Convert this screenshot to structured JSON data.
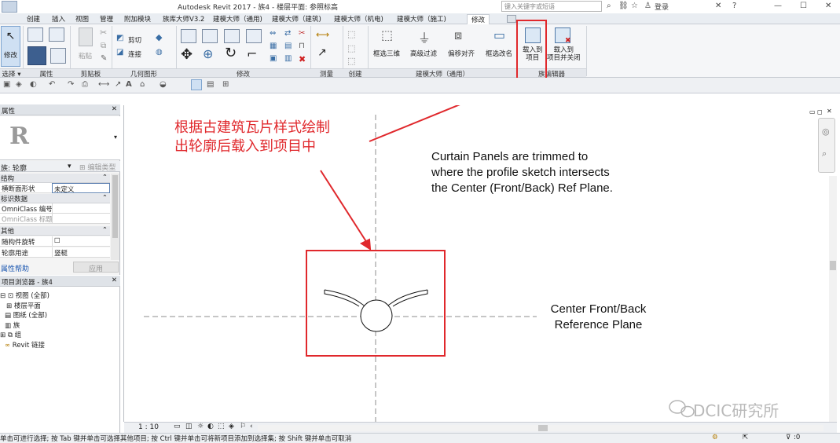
{
  "app": {
    "title": "Autodesk Revit 2017 -     族4 - 楼层平面: 参照标高",
    "search_placeholder": "键入关键字或短语",
    "login_label": "登录"
  },
  "tabs": [
    {
      "label": "创建"
    },
    {
      "label": "插入"
    },
    {
      "label": "视图"
    },
    {
      "label": "管理"
    },
    {
      "label": "附加模块"
    },
    {
      "label": "族库大师V3.2"
    },
    {
      "label": "建模大师（通用)"
    },
    {
      "label": "建模大师（建筑)"
    },
    {
      "label": "建模大师（机电)"
    },
    {
      "label": "建模大师（施工)"
    },
    {
      "label": "修改",
      "active": true
    }
  ],
  "ribbon": {
    "modify_label": "修改",
    "cut_label": "剪切",
    "join_label": "连接",
    "paste_label": "粘贴",
    "btn_box3d": "框选三维",
    "btn_filter": "高级过滤",
    "btn_offset": "偏移对齐",
    "btn_rename": "框选改名",
    "btn_load": "载入到\n项目",
    "btn_load_close": "载入到\n项目并关闭",
    "panels": {
      "select": "选择 ▾",
      "props": "属性",
      "clipboard": "剪贴板",
      "geometry": "几何图形",
      "modify": "修改",
      "measure": "测量",
      "create": "创建",
      "master": "建模大师（通用）",
      "family_editor": "族编辑器"
    }
  },
  "properties": {
    "header": "属性",
    "type_label": "族: 轮廓",
    "edit_type": "编辑类型",
    "sections": [
      {
        "title": "结构",
        "rows": [
          {
            "k": "横断面形状",
            "v": "未定义"
          }
        ]
      },
      {
        "title": "标识数据",
        "rows": [
          {
            "k": "OmniClass 编号",
            "v": ""
          },
          {
            "k": "OmniClass 标题",
            "v": ""
          }
        ]
      },
      {
        "title": "其他",
        "rows": [
          {
            "k": "随构件旋转",
            "v": "☐"
          },
          {
            "k": "轮廓用途",
            "v": "竖梃"
          }
        ]
      }
    ],
    "help_link": "属性帮助",
    "apply_button": "应用"
  },
  "browser": {
    "header": "项目浏览器 - 族4",
    "items": [
      {
        "label": "视图 (全部)",
        "indent": 0
      },
      {
        "label": "楼层平面",
        "indent": 1
      },
      {
        "label": "图纸 (全部)",
        "indent": 0
      },
      {
        "label": "族",
        "indent": 0
      },
      {
        "label": "组",
        "indent": 0
      },
      {
        "label": "Revit 链接",
        "indent": 0
      }
    ]
  },
  "canvas": {
    "annotation_cn": [
      "根据古建筑瓦片样式绘制",
      "出轮廓后载入到项目中"
    ],
    "annotation_en": [
      "Curtain Panels are trimmed to",
      "where the profile sketch intersects",
      "the Center (Front/Back) Ref Plane."
    ],
    "refplane_label": [
      "Center Front/Back",
      "Reference Plane"
    ],
    "watermark": "DCIC研究所",
    "scale": "1 : 10",
    "accent_red": "#e0282c"
  },
  "status": {
    "text": "单击可进行选择; 按 Tab 键并单击可选择其他项目; 按 Ctrl 键并单击可将新项目添加到选择集; 按 Shift 键并单击可取消",
    "filter_count": ":0"
  }
}
